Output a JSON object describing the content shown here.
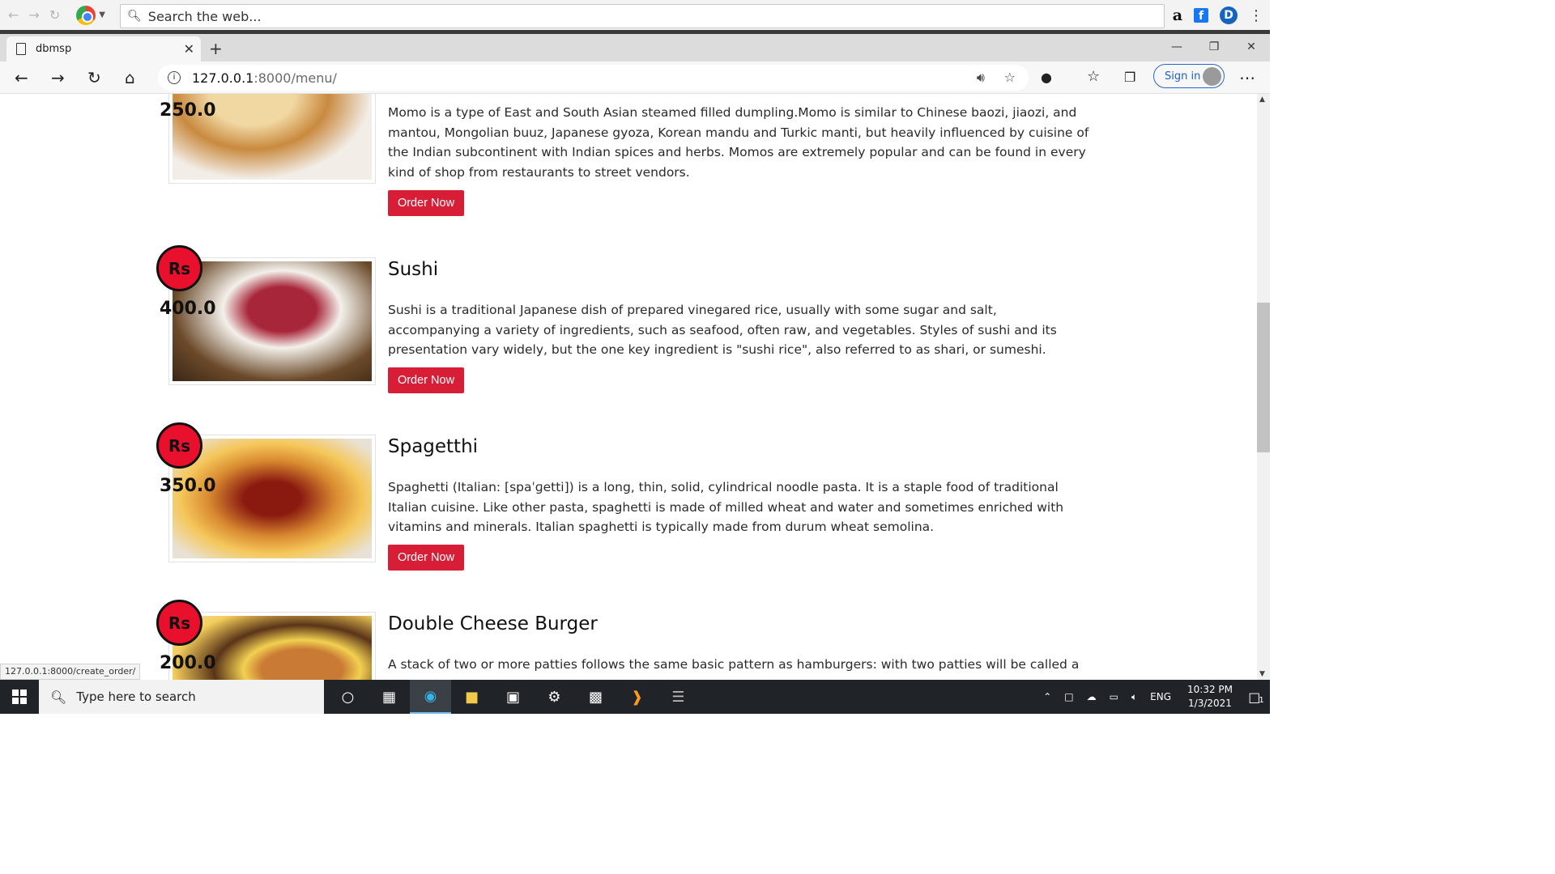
{
  "search_toolbar": {
    "placeholder": "Search the web...",
    "icons": [
      "back-icon",
      "forward-icon",
      "reload-icon",
      "chrome-logo",
      "amazon-icon",
      "facebook-icon",
      "dashlane-icon",
      "menu-icon"
    ]
  },
  "tab": {
    "title": "dbmsp"
  },
  "address": {
    "host": "127.0.0.1",
    "rest": ":8000/menu/",
    "signin": "Sign in"
  },
  "menu": {
    "currency": "Rs",
    "order_label": "Order Now",
    "items": [
      {
        "title": "",
        "price": "250.0",
        "desc": "Momo is a type of East and South Asian steamed filled dumpling.Momo is similar to Chinese baozi, jiaozi, and mantou, Mongolian buuz, Japanese gyoza, Korean mandu and Turkic manti, but heavily influenced by cuisine of the Indian subcontinent with Indian spices and herbs. Momos are extremely popular and can be found in every kind of shop from restaurants to street vendors."
      },
      {
        "title": "Sushi",
        "price": "400.0",
        "desc": "Sushi is a traditional Japanese dish of prepared vinegared rice, usually with some sugar and salt, accompanying a variety of ingredients, such as seafood, often raw, and vegetables. Styles of sushi and its presentation vary widely, but the one key ingredient is \"sushi rice\", also referred to as shari, or sumeshi."
      },
      {
        "title": "Spagetthi",
        "price": "350.0",
        "desc": "Spaghetti (Italian: [spaˈɡetti]) is a long, thin, solid, cylindrical noodle pasta. It is a staple food of traditional Italian cuisine. Like other pasta, spaghetti is made of milled wheat and water and sometimes enriched with vitamins and minerals. Italian spaghetti is typically made from durum wheat semolina."
      },
      {
        "title": "Double Cheese Burger",
        "price": "200.0",
        "desc": "A stack of two or more patties follows the same basic pattern as hamburgers: with two patties will be called a"
      }
    ]
  },
  "status_url": "127.0.0.1:8000/create_order/",
  "taskbar": {
    "search_placeholder": "Type here to search",
    "language": "ENG",
    "time": "10:32 PM",
    "date": "1/3/2021",
    "notification_count": "1"
  },
  "colors": {
    "badge": "#e8102c",
    "order_button": "#d81e36",
    "taskbar": "#202428"
  }
}
